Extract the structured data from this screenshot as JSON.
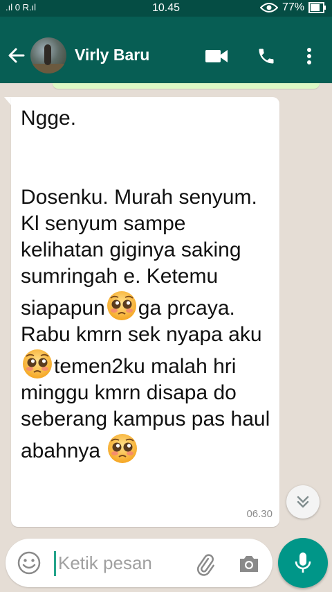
{
  "status_bar": {
    "signal_text": ".ıl 0 R.ıl",
    "time": "10.45",
    "battery_percent": "77%"
  },
  "app_bar": {
    "contact_name": "Virly Baru",
    "icons": [
      "back-arrow-icon",
      "video-call-icon",
      "phone-icon",
      "more-options-icon"
    ]
  },
  "message": {
    "text_blocks": [
      "Ngge.\n\n\nDosenku. Murah senyum. Kl senyum sampe kelihatan giginya saking sumringah e. Ketemu siapapun",
      "ga prcaya. Rabu kmrn sek nyapa aku",
      "temen2ku malah hri minggu kmrn disapa do seberang kampus pas haul abahnya "
    ],
    "emoji": "pleading-face-emoji",
    "time": "06.30"
  },
  "composer": {
    "placeholder": "Ketik pesan"
  },
  "colors": {
    "header": "#075e54",
    "status_bar": "#054d44",
    "chat_background": "#e5ddd5",
    "accent": "#009688"
  }
}
